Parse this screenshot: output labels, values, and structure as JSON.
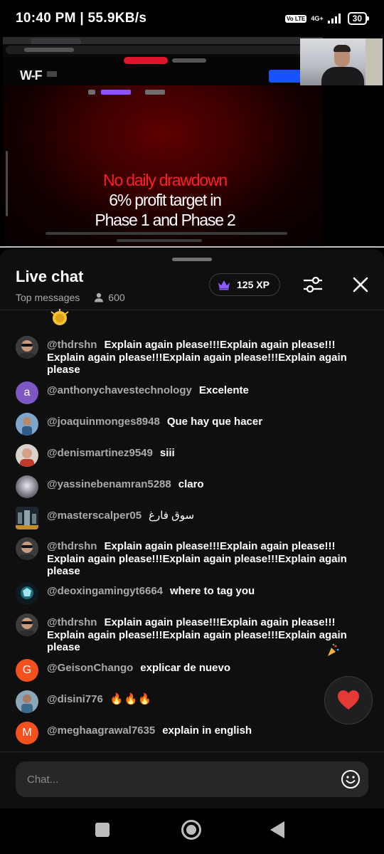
{
  "status_bar": {
    "time_speed": "10:40 PM | 55.9KB/s",
    "volte": "Vo LTE",
    "network": "4G+",
    "battery": "30"
  },
  "video": {
    "logo": "W-F",
    "hero_line1": "No daily drawdown",
    "hero_line2": "6% profit target in",
    "hero_line3": "Phase 1 and Phase 2",
    "hero_color": "#ff1e28"
  },
  "chat": {
    "title": "Live chat",
    "mode": "Top messages",
    "viewers": "600",
    "xp": "125 XP",
    "input_placeholder": "Chat...",
    "messages": [
      {
        "author": "@thdrshn",
        "text": "Explain again please!!!Explain again please!!! Explain again please!!!Explain again please!!!Explain again please",
        "avatar_type": "photo",
        "avatar_color": "#4a4a4a"
      },
      {
        "author": "@anthonychavestechnology",
        "text": "Excelente",
        "avatar_type": "letter",
        "avatar_letter": "a",
        "avatar_color": "#7e57c2"
      },
      {
        "author": "@joaquinmonges8948",
        "text": "Que hay que hacer",
        "avatar_type": "photo",
        "avatar_color": "#6a8fb5"
      },
      {
        "author": "@denismartinez9549",
        "text": "siii",
        "avatar_type": "photo",
        "avatar_color": "#c9a48c"
      },
      {
        "author": "@yassinebenamran5288",
        "text": "claro",
        "avatar_type": "photo",
        "avatar_color": "#8d8a93"
      },
      {
        "author": "@masterscalper05",
        "text": "سوق فارغ",
        "avatar_type": "photo",
        "avatar_color": "#3b4a55"
      },
      {
        "author": "@thdrshn",
        "text": "Explain again please!!!Explain again please!!! Explain again please!!!Explain again please!!!Explain again please",
        "avatar_type": "photo",
        "avatar_color": "#4a4a4a"
      },
      {
        "author": "@deoxingamingyt6664",
        "text": "where to tag you",
        "avatar_type": "photo",
        "avatar_color": "#1e6b7a"
      },
      {
        "author": "@thdrshn",
        "text": "Explain again please!!!Explain again please!!! Explain again please!!!Explain again please!!!Explain again please",
        "avatar_type": "photo",
        "avatar_color": "#4a4a4a"
      },
      {
        "author": "@GeisonChango",
        "text": "explicar de nuevo",
        "avatar_type": "letter",
        "avatar_letter": "G",
        "avatar_color": "#f4511e"
      },
      {
        "author": "@disini776",
        "text": "🔥🔥🔥",
        "avatar_type": "photo",
        "avatar_color": "#5c7f9a"
      },
      {
        "author": "@meghaagrawal7635",
        "text": "explain in english",
        "avatar_type": "letter",
        "avatar_letter": "M",
        "avatar_color": "#f4511e"
      }
    ]
  },
  "icons": {
    "crown": "crown-icon",
    "settings": "sliders-icon",
    "close": "close-icon",
    "heart": "heart-icon",
    "emoji": "emoji-icon",
    "viewer": "person-icon"
  },
  "colors": {
    "panel_bg": "#0f0f0f",
    "xp_crown": "#8e5bff",
    "heart": "#e53935"
  }
}
